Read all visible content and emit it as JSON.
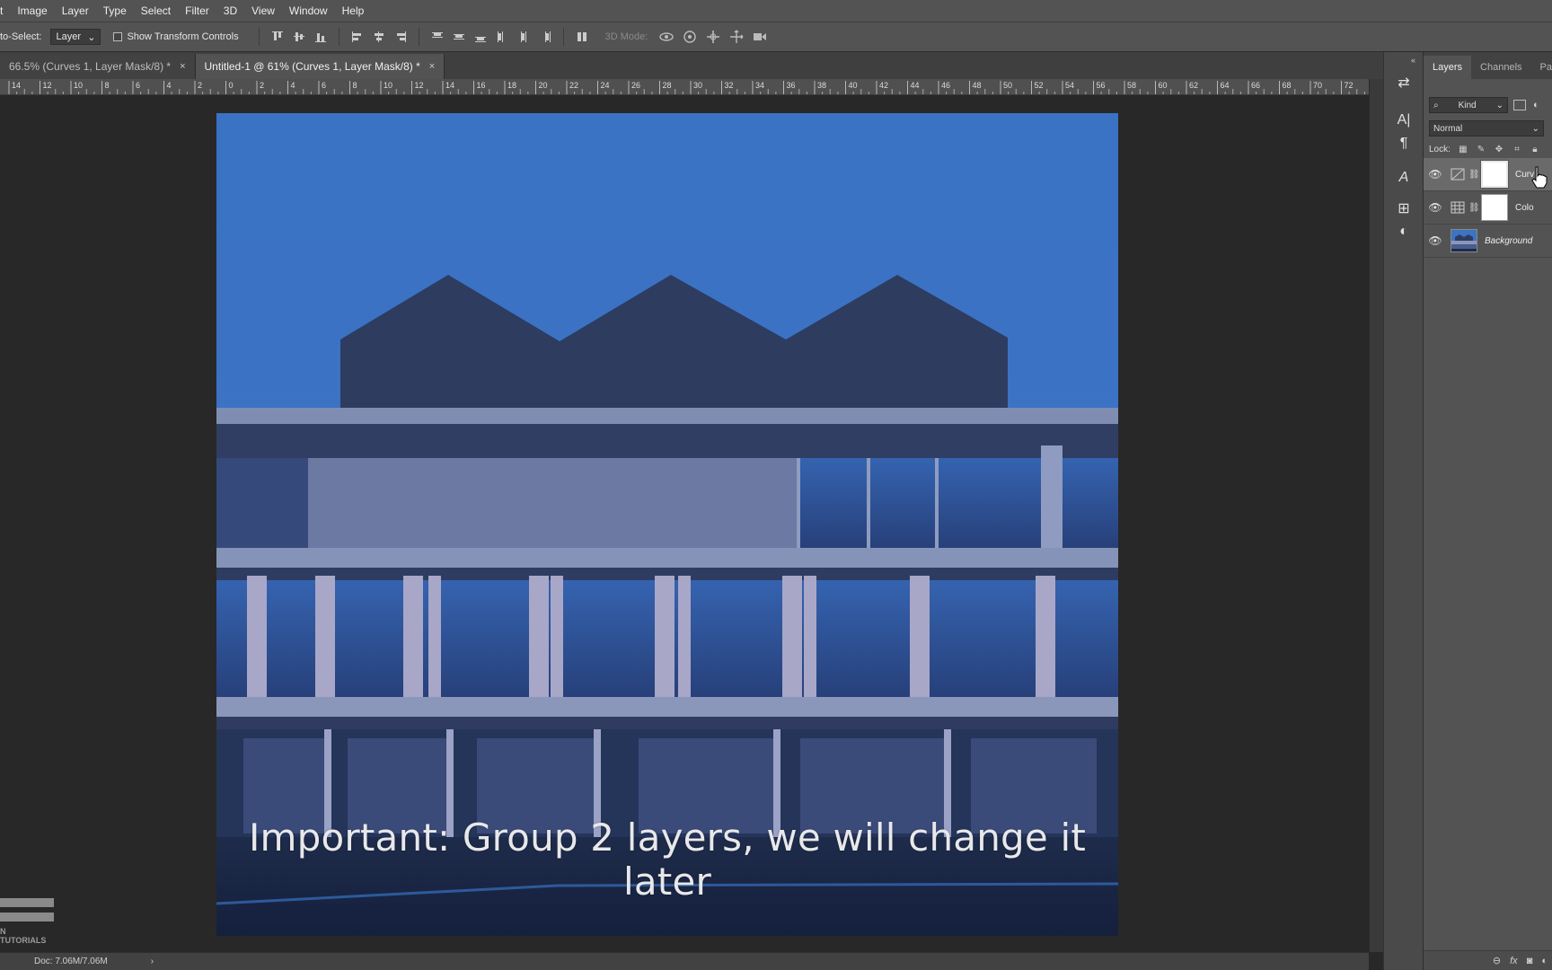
{
  "menu": {
    "items": [
      "Image",
      "Layer",
      "Type",
      "Select",
      "Filter",
      "3D",
      "View",
      "Window",
      "Help"
    ]
  },
  "options": {
    "auto_select_label": "to-Select:",
    "auto_select_value": "Layer",
    "show_transform_label": "Show Transform Controls",
    "mode_3d_label": "3D Mode:"
  },
  "tabs": [
    {
      "label": "66.5% (Curves 1, Layer Mask/8) *",
      "close": "×"
    },
    {
      "label": "Untitled-1 @ 61% (Curves 1, Layer Mask/8) *",
      "close": "×"
    }
  ],
  "ruler": {
    "labels": [
      "14",
      "12",
      "10",
      "8",
      "6",
      "4",
      "2",
      "0",
      "2",
      "4",
      "6",
      "8",
      "10",
      "12",
      "14",
      "16",
      "18",
      "20",
      "22",
      "24",
      "26",
      "28",
      "30",
      "32",
      "34",
      "36",
      "38",
      "40",
      "42",
      "44",
      "46",
      "48",
      "50",
      "52",
      "54",
      "56",
      "58",
      "60",
      "62",
      "64",
      "66",
      "68",
      "70",
      "72"
    ]
  },
  "canvas": {
    "caption": "Important: Group 2 layers, we will change it later"
  },
  "watermark": {
    "text": "N TUTORIALS"
  },
  "status": {
    "doc": "Doc: 7.06M/7.06M",
    "arrow": "›"
  },
  "panel": {
    "tabs": [
      "Layers",
      "Channels",
      "Paths"
    ],
    "kind_label": "Kind",
    "blend_mode": "Normal",
    "lock_label": "Lock:",
    "layers": [
      {
        "name": "Curv",
        "type": "curves",
        "selected": true
      },
      {
        "name": "Colo",
        "type": "color-lookup",
        "selected": false
      },
      {
        "name": "Background",
        "type": "background",
        "selected": false
      }
    ],
    "footer": [
      "fx"
    ]
  },
  "colors": {
    "sky_top": "#3f76c6",
    "sky_bottom": "#3a6fc0",
    "building_dark": "#2c3a5c",
    "facade_light": "#8d9bc0"
  }
}
